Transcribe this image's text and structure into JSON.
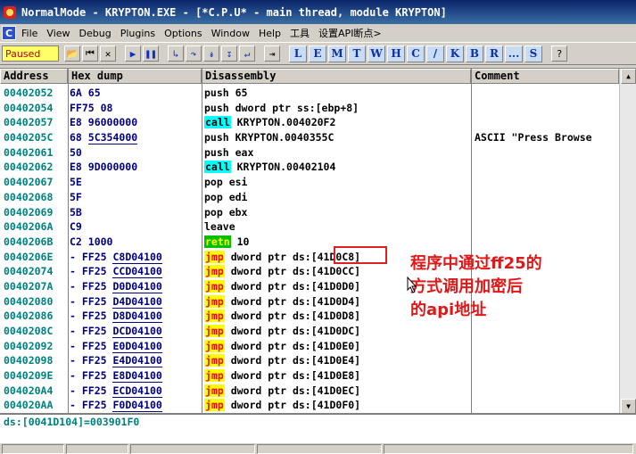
{
  "title": "NormalMode - KRYPTON.EXE - [*C.P.U* - main thread, module KRYPTON]",
  "menu": [
    "File",
    "View",
    "Debug",
    "Plugins",
    "Options",
    "Window",
    "Help",
    "工具",
    "设置API断点>"
  ],
  "menu_sys_label": "C",
  "status": "Paused",
  "toolbar_icons": [
    "open-icon",
    "restart-icon",
    "close-icon",
    "run-icon",
    "pause-icon",
    "step-into-icon",
    "step-over-icon",
    "trace-into-icon",
    "trace-over-icon",
    "execute-till-return-icon",
    "goto-icon"
  ],
  "toolbar_letters": [
    "L",
    "E",
    "M",
    "T",
    "W",
    "H",
    "C",
    "/",
    "K",
    "B",
    "R",
    "...",
    "S"
  ],
  "columns": {
    "address": "Address",
    "hex": "Hex dump",
    "disasm": "Disassembly",
    "comment": "Comment"
  },
  "rows": [
    {
      "addr": "00402052",
      "hex": "6A 65",
      "op": "",
      "args": "push 65",
      "comment": ""
    },
    {
      "addr": "00402054",
      "hex": "FF75 08",
      "op": "",
      "args": "push dword ptr ss:[ebp+8]",
      "comment": ""
    },
    {
      "addr": "00402057",
      "hex": "E8 96000000",
      "op": "call",
      "args": " KRYPTON.004020F2",
      "comment": ""
    },
    {
      "addr": "0040205C",
      "hex": "68 5C354000",
      "op": "",
      "args": "push KRYPTON.0040355C",
      "comment": "ASCII \"Press Browse"
    },
    {
      "addr": "00402061",
      "hex": "50",
      "op": "",
      "args": "push eax",
      "comment": ""
    },
    {
      "addr": "00402062",
      "hex": "E8 9D000000",
      "op": "call",
      "args": " KRYPTON.00402104",
      "comment": ""
    },
    {
      "addr": "00402067",
      "hex": "5E",
      "op": "",
      "args": "pop esi",
      "comment": ""
    },
    {
      "addr": "00402068",
      "hex": "5F",
      "op": "",
      "args": "pop edi",
      "comment": ""
    },
    {
      "addr": "00402069",
      "hex": "5B",
      "op": "",
      "args": "pop ebx",
      "comment": ""
    },
    {
      "addr": "0040206A",
      "hex": "C9",
      "op": "",
      "args": "leave",
      "comment": ""
    },
    {
      "addr": "0040206B",
      "hex": "C2 1000",
      "op": "retn",
      "args": " 10",
      "comment": ""
    },
    {
      "addr": "0040206E",
      "hex": "- FF25 C8D04100",
      "op": "jmp",
      "args": " dword ptr ds:[41D0C8]",
      "comment": ""
    },
    {
      "addr": "00402074",
      "hex": "- FF25 CCD04100",
      "op": "jmp",
      "args": " dword ptr ds:[41D0CC]",
      "comment": ""
    },
    {
      "addr": "0040207A",
      "hex": "- FF25 D0D04100",
      "op": "jmp",
      "args": " dword ptr ds:[41D0D0]",
      "comment": ""
    },
    {
      "addr": "00402080",
      "hex": "- FF25 D4D04100",
      "op": "jmp",
      "args": " dword ptr ds:[41D0D4]",
      "comment": ""
    },
    {
      "addr": "00402086",
      "hex": "- FF25 D8D04100",
      "op": "jmp",
      "args": " dword ptr ds:[41D0D8]",
      "comment": ""
    },
    {
      "addr": "0040208C",
      "hex": "- FF25 DCD04100",
      "op": "jmp",
      "args": " dword ptr ds:[41D0DC]",
      "comment": ""
    },
    {
      "addr": "00402092",
      "hex": "- FF25 E0D04100",
      "op": "jmp",
      "args": " dword ptr ds:[41D0E0]",
      "comment": ""
    },
    {
      "addr": "00402098",
      "hex": "- FF25 E4D04100",
      "op": "jmp",
      "args": " dword ptr ds:[41D0E4]",
      "comment": ""
    },
    {
      "addr": "0040209E",
      "hex": "- FF25 E8D04100",
      "op": "jmp",
      "args": " dword ptr ds:[41D0E8]",
      "comment": ""
    },
    {
      "addr": "004020A4",
      "hex": "- FF25 ECD04100",
      "op": "jmp",
      "args": " dword ptr ds:[41D0EC]",
      "comment": ""
    },
    {
      "addr": "004020AA",
      "hex": "- FF25 F0D04100",
      "op": "jmp",
      "args": " dword ptr ds:[41D0F0]",
      "comment": ""
    }
  ],
  "annotation": [
    "程序中通过ff25的",
    "方式调用加密后",
    "的api地址"
  ],
  "info": "ds:[0041D104]=003901F0",
  "colors": {
    "address": "#008080",
    "call_bg": "#00ffff",
    "jmp_bg": "#ffff00",
    "jmp_fg": "#ff0000",
    "retn_bg": "#00c000",
    "annotation": "#e01818"
  }
}
